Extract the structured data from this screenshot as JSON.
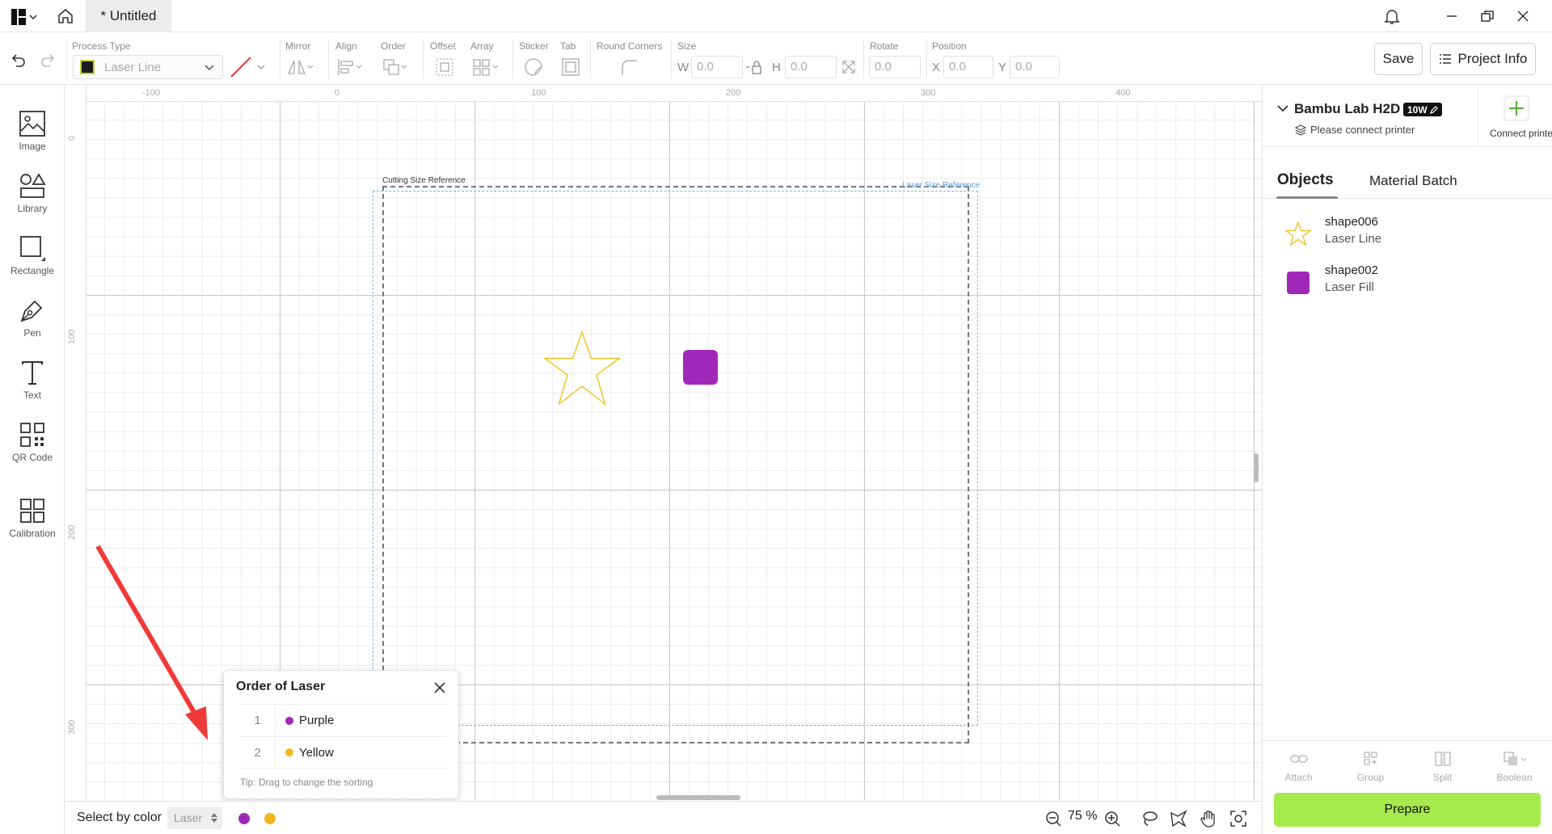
{
  "titlebar": {
    "tab_title": "* Untitled"
  },
  "toolbar": {
    "process_type_label": "Process Type",
    "process_type_value": "Laser Line",
    "mirror_label": "Mirror",
    "align_label": "Align",
    "order_label": "Order",
    "offset_label": "Offset",
    "array_label": "Array",
    "sticker_label": "Sticker",
    "tab_label": "Tab",
    "round_corners_label": "Round Corners",
    "size_label": "Size",
    "w_label": "W",
    "w_value": "0.0",
    "h_label": "H",
    "h_value": "0.0",
    "rotate_label": "Rotate",
    "rotate_value": "0.0",
    "position_label": "Position",
    "x_label": "X",
    "x_value": "0.0",
    "y_label": "Y",
    "y_value": "0.0",
    "save_label": "Save",
    "project_info_label": "Project Info"
  },
  "sidebar": {
    "items": [
      {
        "label": "Image",
        "icon": "image-icon"
      },
      {
        "label": "Library",
        "icon": "library-icon"
      },
      {
        "label": "Rectangle",
        "icon": "rectangle-icon"
      },
      {
        "label": "Pen",
        "icon": "pen-icon"
      },
      {
        "label": "Text",
        "icon": "text-icon"
      },
      {
        "label": "QR Code",
        "icon": "qr-code-icon"
      },
      {
        "label": "Calibration",
        "icon": "calibration-icon"
      }
    ]
  },
  "canvas": {
    "ruler_top": [
      "-100",
      "0",
      "100",
      "200",
      "300",
      "400"
    ],
    "ruler_left": [
      "0",
      "100",
      "200",
      "300"
    ],
    "cutting_ref_label": "Cutting Size Reference",
    "laser_ref_label": "Laser Size Reference",
    "star_color": "#f0c020",
    "square_color": "#a028b8"
  },
  "order_popup": {
    "title": "Order of Laser",
    "rows": [
      {
        "num": "1",
        "label": "Purple",
        "color": "#a028b8"
      },
      {
        "num": "2",
        "label": "Yellow",
        "color": "#f0b820"
      }
    ],
    "tip": "Tip: Drag to change the sorting"
  },
  "bottombar": {
    "select_by_color_label": "Select by color",
    "select_value": "Laser",
    "color_dots": [
      "#a028b8",
      "#f0b820"
    ],
    "zoom": "75 %"
  },
  "rpanel": {
    "printer_name": "Bambu Lab H2D",
    "printer_badge": "10W",
    "printer_status": "Please connect printer",
    "connect_label": "Connect printer",
    "tabs": [
      "Objects",
      "Material Batch"
    ],
    "objects": [
      {
        "name": "shape006",
        "type": "Laser Line"
      },
      {
        "name": "shape002",
        "type": "Laser Fill"
      }
    ],
    "actions": [
      "Attach",
      "Group",
      "Split",
      "Boolean"
    ],
    "prepare_label": "Prepare"
  }
}
